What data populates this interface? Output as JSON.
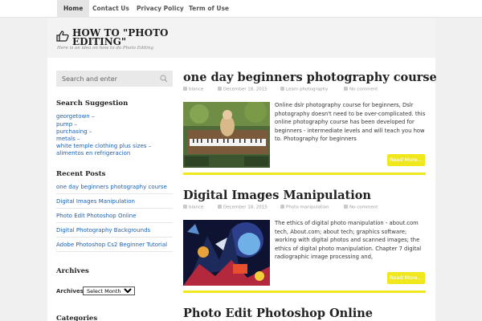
{
  "nav": {
    "items": [
      {
        "label": "Home"
      },
      {
        "label": "Contact Us"
      },
      {
        "label": "Privacy Policy"
      },
      {
        "label": "Term of Use"
      }
    ]
  },
  "site": {
    "title": "HOW TO \"PHOTO EDITING\"",
    "tagline": "Here is an idea on how to do Photo Editing"
  },
  "sidebar": {
    "search": {
      "placeholder": "Search and enter"
    },
    "suggestion_title": "Search Suggestion",
    "suggestions": [
      "georgetown",
      "pump",
      "purchasing",
      "metals",
      "white temple clothing plus sizes",
      "alimentos en refrigeracion"
    ],
    "suggestion_separator": " –",
    "recent_title": "Recent Posts",
    "recent_posts": [
      "one day beginners photography course",
      "Digital Images Manipulation",
      "Photo Edit Photoshop Online",
      "Digital Photography Backgrounds",
      "Adobe Photoshop Cs2 Beginner Tutorial"
    ],
    "archives_title": "Archives",
    "archives_label": "Archives",
    "archives_select": "Select Month",
    "categories_title": "Categories"
  },
  "posts": [
    {
      "title": "one day beginners photography course",
      "author": "blance",
      "date": "December 18, 2015",
      "category": "Learn photography",
      "comments": "No comment",
      "excerpt": "Online dslr photography course for beginners, Dslr photography doesn't need to be over-complicated. this online photography course has been developed for beginners - intermediate levels and will teach you how to. Photography for beginners",
      "read_more": "Read More..."
    },
    {
      "title": "Digital Images Manipulation",
      "author": "blance",
      "date": "December 18, 2015",
      "category": "Photo manipulation",
      "comments": "No comment",
      "excerpt": "The ethics of digital photo manipulation - about.com tech, About.com; about tech; graphics software; working with digital photos and scanned images; the ethics of digital photo manipulation. Chapter 7 digital radiographic image processing and,",
      "read_more": "Read More..."
    },
    {
      "title": "Photo Edit Photoshop Online"
    }
  ],
  "colors": {
    "accent": "#f0e81c",
    "link": "#1a5fb4"
  }
}
